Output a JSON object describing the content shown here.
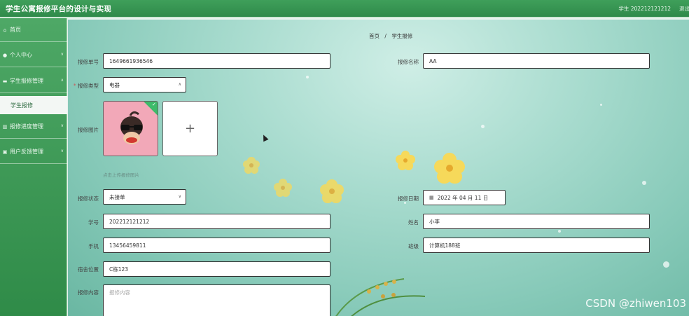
{
  "header": {
    "title": "学生公寓报修平台的设计与实现",
    "user_info": "学生 202212121212",
    "logout": "退出"
  },
  "sidebar": {
    "items": [
      {
        "label": "首页",
        "icon": "home-icon"
      },
      {
        "label": "个人中心",
        "icon": "user-icon"
      },
      {
        "label": "学生报修管理",
        "icon": "wrench-icon"
      },
      {
        "label": "报修进度管理",
        "icon": "progress-icon"
      },
      {
        "label": "用户反馈管理",
        "icon": "feedback-icon"
      }
    ],
    "subitem": "学生报修"
  },
  "breadcrumb": {
    "home": "首页",
    "separator": "/",
    "current": "学生报修"
  },
  "form": {
    "repair_no": {
      "label": "报修单号",
      "value": "1649661936546"
    },
    "repair_name": {
      "label": "报修名称",
      "value": "AA"
    },
    "repair_type": {
      "label": "报修类型",
      "value": "电器"
    },
    "repair_image": {
      "label": "报修图片",
      "tip": "点击上传报修图片"
    },
    "repair_status": {
      "label": "报修状态",
      "value": "未接单"
    },
    "repair_date": {
      "label": "报修日期",
      "value": "2022 年 04 月 11 日"
    },
    "student_no": {
      "label": "学号",
      "value": "202212121212"
    },
    "name": {
      "label": "姓名",
      "value": "小李"
    },
    "phone": {
      "label": "手机",
      "value": "13456459811"
    },
    "class": {
      "label": "班级",
      "value": "计算机188班"
    },
    "dorm": {
      "label": "宿舍位置",
      "value": "C栋123"
    },
    "content": {
      "label": "报修内容",
      "placeholder": "报修内容"
    }
  },
  "icons": {
    "upload_add": "+",
    "calendar": "calendar-icon",
    "check": "✓"
  },
  "watermark": "CSDN @zhiwen103",
  "colors": {
    "header": "#2f8a4a",
    "sidebar": "#3e9a57",
    "accent": "#3dbb6a"
  }
}
